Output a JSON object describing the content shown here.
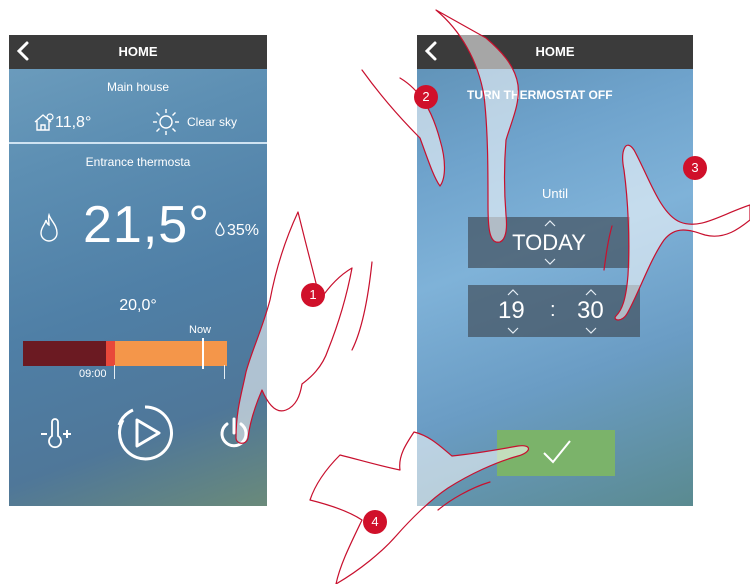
{
  "left_screen": {
    "header_title": "HOME",
    "location_name": "Main house",
    "outdoor_temperature": "11,8°",
    "weather": "Clear sky",
    "thermostat_name": "Entrance thermosta",
    "current_temperature": "21,5°",
    "humidity": "35%",
    "setpoint": "20,0°",
    "now_label": "Now",
    "time_start": "09:00",
    "buttons": {
      "temp_adjust_icon": "thermometer-plus-icon",
      "program_icon": "play-circle-icon",
      "power_icon": "power-icon"
    }
  },
  "right_screen": {
    "header_title": "HOME",
    "heading": "TURN THERMOSTAT OFF",
    "until_label": "Until",
    "day_value": "TODAY",
    "hour_value": "19",
    "separator": ":",
    "minute_value": "30",
    "confirm_icon": "checkmark-icon"
  },
  "steps": [
    "1",
    "2",
    "3",
    "4"
  ],
  "colors": {
    "badge": "#d0102a",
    "topbar": "#3b3b3b",
    "bar_dark": "#6b1a22",
    "bar_orange": "#f4964a",
    "confirm": "#7bb36a",
    "hand_outline": "#c8102e"
  }
}
